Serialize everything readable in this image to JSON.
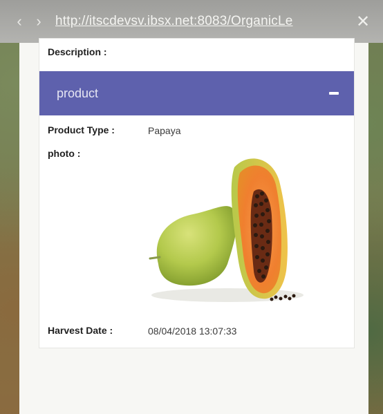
{
  "browser": {
    "url": "http://itscdevsv.ibsx.net:8083/OrganicLe",
    "back_glyph": "‹",
    "forward_glyph": "›",
    "close_glyph": "✕"
  },
  "details": {
    "description_label": "Description :",
    "panel_title": "product",
    "product_type_label": "Product Type :",
    "product_type_value": "Papaya",
    "photo_label": "photo :",
    "harvest_date_label": "Harvest Date :",
    "harvest_date_value": "08/04/2018 13:07:33"
  },
  "colors": {
    "panel_header": "#5e61ad",
    "card_background": "#ffffff",
    "address_bar": "#a8a8a5"
  },
  "icons": {
    "back": "chevron-left-icon",
    "forward": "chevron-right-icon",
    "close": "close-icon",
    "collapse": "minus-icon"
  }
}
